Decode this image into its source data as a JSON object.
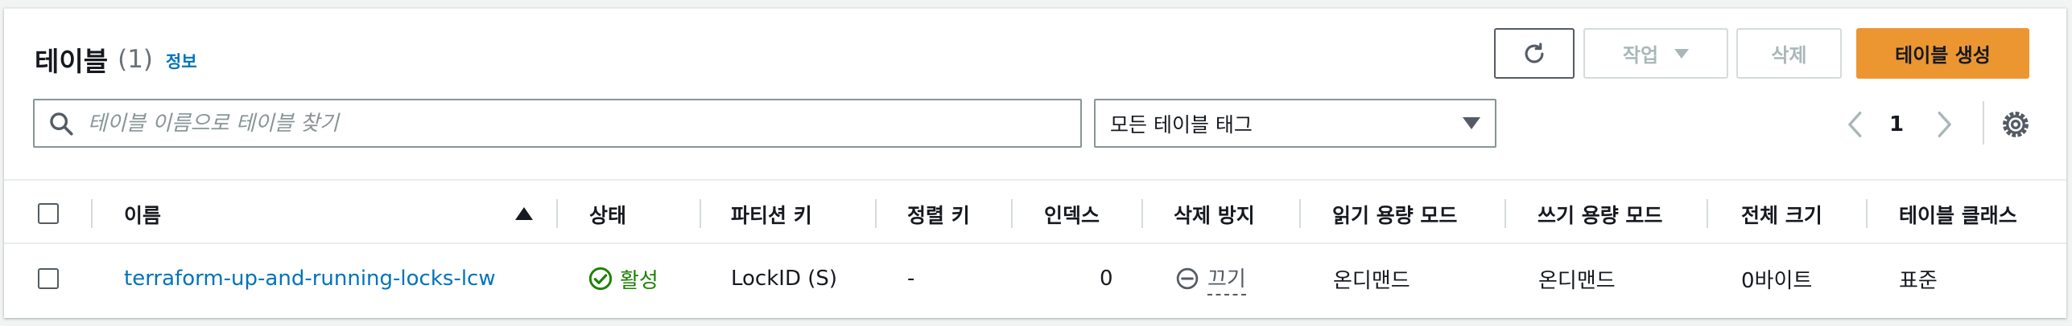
{
  "header": {
    "title": "테이블",
    "count": "(1)",
    "info_link": "정보"
  },
  "toolbar": {
    "actions_label": "작업",
    "delete_label": "삭제",
    "create_label": "테이블 생성"
  },
  "search": {
    "placeholder": "테이블 이름으로 테이블 찾기",
    "value": ""
  },
  "tag_filter": {
    "selected": "모든 테이블 태그"
  },
  "pagination": {
    "current_page": "1"
  },
  "table": {
    "columns": [
      "이름",
      "상태",
      "파티션 키",
      "정렬 키",
      "인덱스",
      "삭제 방지",
      "읽기 용량 모드",
      "쓰기 용량 모드",
      "전체 크기",
      "테이블 클래스"
    ],
    "sort": {
      "column": "이름",
      "direction": "ascending"
    },
    "rows": [
      {
        "name": "terraform-up-and-running-locks-lcw",
        "status": "활성",
        "partition_key": "LockID (S)",
        "sort_key": "-",
        "indexes": "0",
        "deletion_protection": "끄기",
        "read_capacity_mode": "온디맨드",
        "write_capacity_mode": "온디맨드",
        "total_size": "0바이트",
        "table_class": "표준"
      }
    ]
  },
  "colors": {
    "accent_link": "#0073bb",
    "primary_button": "#ec9632",
    "status_active": "#1d8102"
  },
  "icons": [
    "refresh-icon",
    "caret-down-icon",
    "search-icon",
    "chevron-left-icon",
    "chevron-right-icon",
    "settings-gear-icon",
    "sort-ascending-icon",
    "success-check-icon",
    "minus-circle-icon"
  ]
}
